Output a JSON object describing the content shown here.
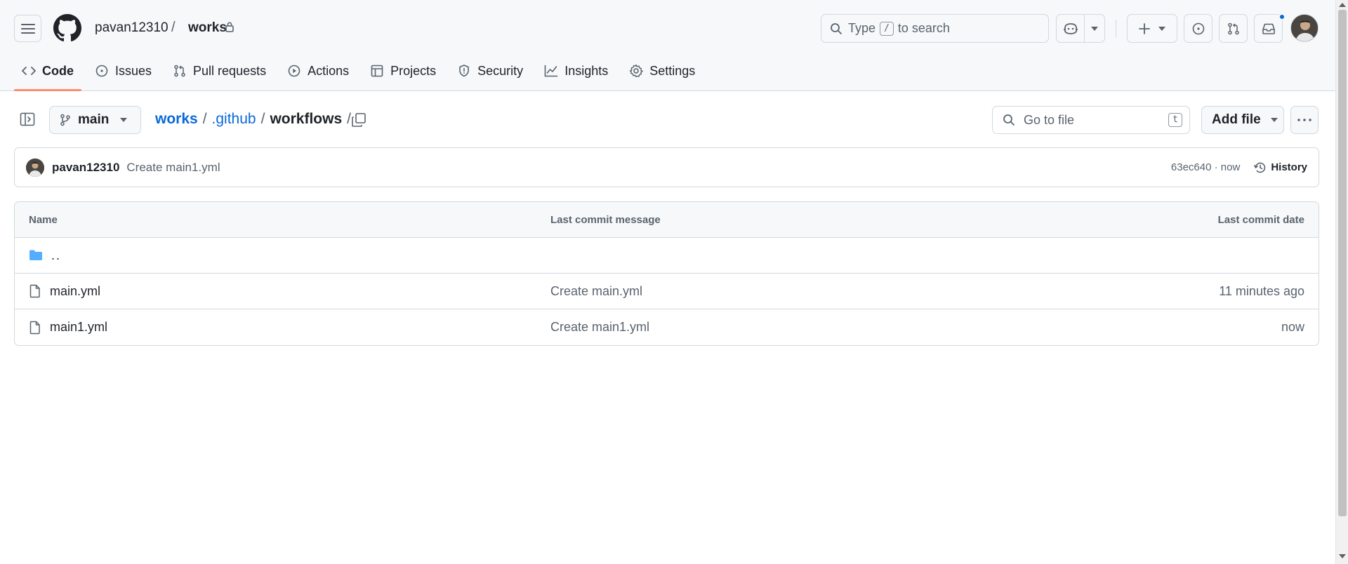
{
  "header": {
    "owner": "pavan12310",
    "separator": "/",
    "repo": "works",
    "search_text_before": "Type",
    "search_key": "/",
    "search_text_after": "to search"
  },
  "nav": {
    "tabs": [
      {
        "label": "Code",
        "active": true
      },
      {
        "label": "Issues"
      },
      {
        "label": "Pull requests"
      },
      {
        "label": "Actions"
      },
      {
        "label": "Projects"
      },
      {
        "label": "Security"
      },
      {
        "label": "Insights"
      },
      {
        "label": "Settings"
      }
    ]
  },
  "subheader": {
    "branch": "main",
    "breadcrumb": {
      "root": "works",
      "parent": ".github",
      "current": "workflows",
      "sep": "/"
    },
    "goto_placeholder": "Go to file",
    "goto_key": "t",
    "add_file": "Add file"
  },
  "commit": {
    "author": "pavan12310",
    "message": "Create main1.yml",
    "sha_time": "63ec640 · now",
    "history": "History"
  },
  "table": {
    "headers": {
      "name": "Name",
      "message": "Last commit message",
      "date": "Last commit date"
    },
    "parent": "..",
    "rows": [
      {
        "name": "main.yml",
        "message": "Create main.yml",
        "date": "11 minutes ago"
      },
      {
        "name": "main1.yml",
        "message": "Create main1.yml",
        "date": "now"
      }
    ]
  },
  "colors": {
    "link": "#0969da",
    "active_tab_underline": "#fd8c73",
    "folder": "#54aeff",
    "notification": "#0969da"
  }
}
